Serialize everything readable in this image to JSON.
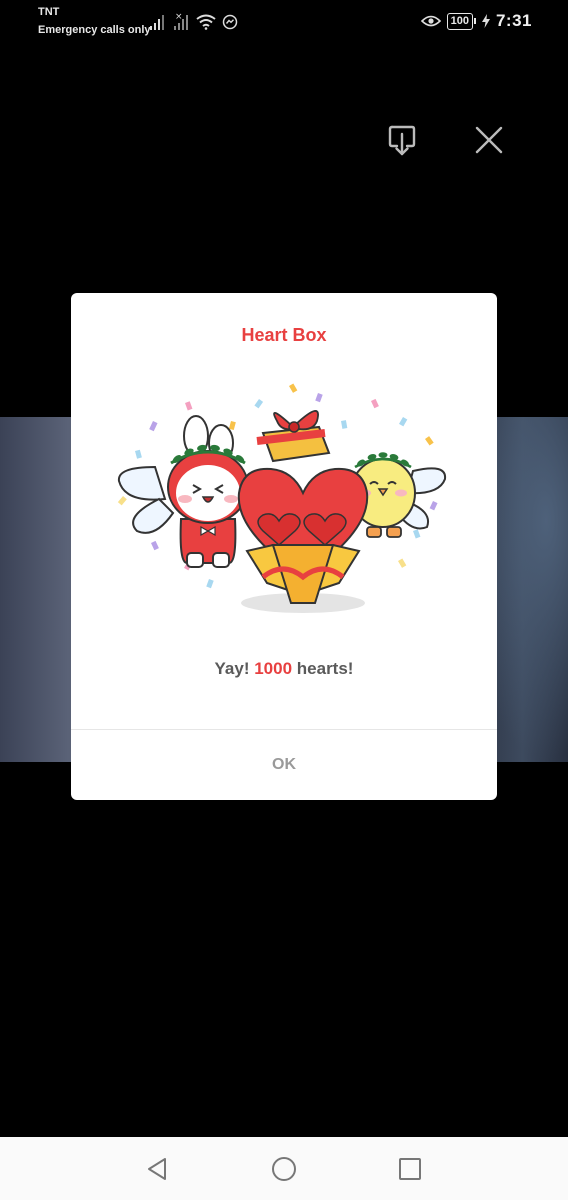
{
  "status_bar": {
    "carrier": "TNT",
    "emergency_text": "Emergency calls only",
    "battery_level": "100",
    "time": "7:31",
    "icons": [
      "signal-icon",
      "signal-no-sim-icon",
      "wifi-icon",
      "messenger-icon",
      "eye-comfort-icon",
      "battery-icon",
      "charging-icon"
    ]
  },
  "viewer": {
    "icons": [
      "download-icon",
      "close-icon"
    ]
  },
  "dialog": {
    "title": "Heart Box",
    "message_prefix": "Yay! ",
    "message_count": "1000",
    "message_suffix": " hearts!",
    "ok_label": "OK",
    "title_color": "#e84040",
    "illustration": "heart-box-gift-illustration"
  },
  "nav_bar": {
    "icons": [
      "back-icon",
      "home-icon",
      "recents-icon"
    ]
  }
}
